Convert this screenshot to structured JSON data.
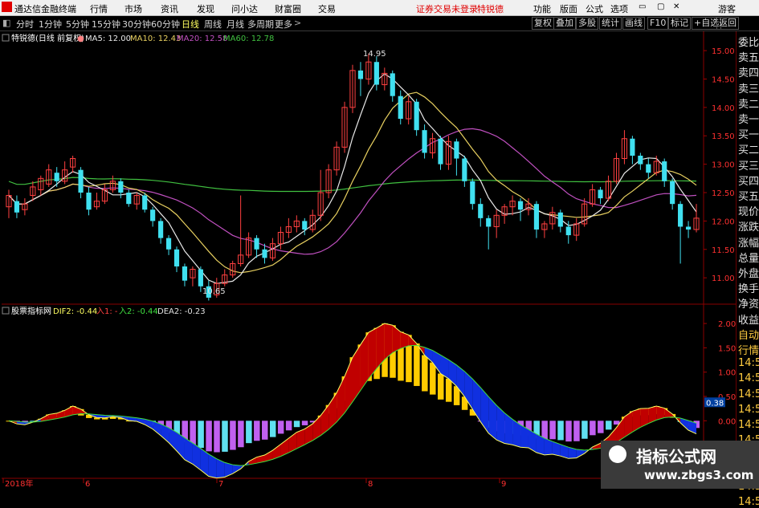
{
  "menubar": {
    "app_title": "通达信金融终端",
    "menus": [
      "行情",
      "市场",
      "资讯",
      "发现",
      "问小达",
      "财富圈",
      "交易"
    ],
    "status": "证券交易未登录",
    "stock": "特锐德",
    "right": [
      "功能",
      "版面",
      "公式",
      "选项",
      "游客"
    ]
  },
  "periodbar": {
    "periods": [
      "分时",
      "1分钟",
      "5分钟",
      "15分钟",
      "30分钟",
      "60分钟",
      "日线",
      "周线",
      "月线",
      "多周期",
      "更多"
    ],
    "active": "日线",
    "tools": [
      "复权",
      "叠加",
      "多股",
      "统计",
      "画线",
      "F10",
      "标记",
      "+自选",
      "返回"
    ]
  },
  "main_panel": {
    "title": "特锐德(日线 前复权)",
    "ma": [
      {
        "label": "MA5: 12.00",
        "color": "#e8e8e8"
      },
      {
        "label": "MA10: 12.43",
        "color": "#e8d060"
      },
      {
        "label": "MA20: 12.58",
        "color": "#c050c0"
      },
      {
        "label": "MA60: 12.78",
        "color": "#40c040"
      }
    ],
    "high_label": "14.95",
    "low_label": "10.65",
    "price_ticks": [
      "15.00",
      "14.50",
      "14.00",
      "13.50",
      "13.00",
      "12.50",
      "12.00",
      "11.50",
      "11.00"
    ]
  },
  "sub_panel": {
    "title": "股票指标网",
    "dif": "DIF2: -0.44",
    "in1": "入1: -",
    "in2": "入2: -0.44",
    "dea": "DEA2: -0.23",
    "ticks": [
      "2.00",
      "1.50",
      "1.00",
      "0.50",
      "0.00"
    ],
    "tag_value": "0.38"
  },
  "date_axis": [
    "2018年",
    "6",
    "7",
    "8",
    "9"
  ],
  "right_panel": [
    "委比",
    "卖五",
    "卖四",
    "卖三",
    "卖二",
    "卖一",
    "买一",
    "买二",
    "买三",
    "买四",
    "买五",
    "现价",
    "涨跌",
    "涨幅",
    "总量",
    "外盘",
    "换手",
    "净资",
    "收益",
    "自动",
    "行情",
    "14:50",
    "14:50",
    "14:50",
    "14:50",
    "14:50",
    "14:50",
    "14:50",
    "14:50",
    "14:50",
    "14:50"
  ],
  "watermark": {
    "title": "指标公式网",
    "url": "www.zbgs3.com"
  },
  "colors": {
    "up": "#ff4040",
    "down": "#40e0f0",
    "macd_pos": "#ffcc00",
    "macd_neg": "#c060f0",
    "bg": "#000000"
  },
  "chart_data": {
    "type": "candlestick",
    "note": "daily candles, prices estimated",
    "candles": [
      [
        12.25,
        12.45,
        12.05,
        12.55
      ],
      [
        12.35,
        12.15,
        12.05,
        12.45
      ],
      [
        12.2,
        12.3,
        12.1,
        12.4
      ],
      [
        12.45,
        12.6,
        12.35,
        12.7
      ],
      [
        12.55,
        12.75,
        12.45,
        12.8
      ],
      [
        12.65,
        12.9,
        12.6,
        13.0
      ],
      [
        12.85,
        12.7,
        12.6,
        12.95
      ],
      [
        12.7,
        12.9,
        12.65,
        13.05
      ],
      [
        12.95,
        13.1,
        12.85,
        13.15
      ],
      [
        12.9,
        12.5,
        12.4,
        12.95
      ],
      [
        12.5,
        12.2,
        12.1,
        12.6
      ],
      [
        12.25,
        12.35,
        12.2,
        12.5
      ],
      [
        12.35,
        12.55,
        12.3,
        12.65
      ],
      [
        12.55,
        12.7,
        12.5,
        12.8
      ],
      [
        12.7,
        12.5,
        12.4,
        12.75
      ],
      [
        12.5,
        12.3,
        12.25,
        12.55
      ],
      [
        12.3,
        12.45,
        12.2,
        12.5
      ],
      [
        12.45,
        12.2,
        12.15,
        12.5
      ],
      [
        12.2,
        12.0,
        11.9,
        12.25
      ],
      [
        12.0,
        11.7,
        11.6,
        12.05
      ],
      [
        11.7,
        11.5,
        11.4,
        11.75
      ],
      [
        11.5,
        11.2,
        11.1,
        11.55
      ],
      [
        11.2,
        10.95,
        10.85,
        11.25
      ],
      [
        11.0,
        11.15,
        10.85,
        11.2
      ],
      [
        11.15,
        10.85,
        10.75,
        11.2
      ],
      [
        10.85,
        10.65,
        10.6,
        10.95
      ],
      [
        10.7,
        10.9,
        10.65,
        11.0
      ],
      [
        10.9,
        11.05,
        10.85,
        11.15
      ],
      [
        11.05,
        11.25,
        11.0,
        11.3
      ],
      [
        11.25,
        11.4,
        11.2,
        12.45
      ],
      [
        11.4,
        11.7,
        11.35,
        11.8
      ],
      [
        11.7,
        11.5,
        11.35,
        11.75
      ],
      [
        11.5,
        11.35,
        11.25,
        11.6
      ],
      [
        11.35,
        11.6,
        11.3,
        11.7
      ],
      [
        11.6,
        11.8,
        11.5,
        11.9
      ],
      [
        11.8,
        11.9,
        11.7,
        12.05
      ],
      [
        11.9,
        12.0,
        11.8,
        12.1
      ],
      [
        12.0,
        11.85,
        11.75,
        12.05
      ],
      [
        11.85,
        12.1,
        11.8,
        12.2
      ],
      [
        12.1,
        12.5,
        12.0,
        12.9
      ],
      [
        12.5,
        12.9,
        12.4,
        13.0
      ],
      [
        12.9,
        13.3,
        12.8,
        13.4
      ],
      [
        13.3,
        14.0,
        13.2,
        14.1
      ],
      [
        14.0,
        14.65,
        13.9,
        14.75
      ],
      [
        14.65,
        14.5,
        14.2,
        14.8
      ],
      [
        14.5,
        14.8,
        14.4,
        14.95
      ],
      [
        14.8,
        14.4,
        14.3,
        14.9
      ],
      [
        14.4,
        14.6,
        14.3,
        14.7
      ],
      [
        14.6,
        14.2,
        14.1,
        14.65
      ],
      [
        14.2,
        13.8,
        13.7,
        14.3
      ],
      [
        13.8,
        14.1,
        13.7,
        14.2
      ],
      [
        14.1,
        13.6,
        13.5,
        14.15
      ],
      [
        13.6,
        13.2,
        13.1,
        13.7
      ],
      [
        13.2,
        13.45,
        13.1,
        13.55
      ],
      [
        13.45,
        13.0,
        12.9,
        13.5
      ],
      [
        13.0,
        13.4,
        12.9,
        13.5
      ],
      [
        13.4,
        13.1,
        12.8,
        13.45
      ],
      [
        13.1,
        12.7,
        12.6,
        13.15
      ],
      [
        12.7,
        12.3,
        12.2,
        12.75
      ],
      [
        12.3,
        12.05,
        11.9,
        12.4
      ],
      [
        12.05,
        11.9,
        11.5,
        12.1
      ],
      [
        11.9,
        12.1,
        11.7,
        12.2
      ],
      [
        12.1,
        12.25,
        11.95,
        12.3
      ],
      [
        12.25,
        12.35,
        12.1,
        12.45
      ],
      [
        12.35,
        12.2,
        12.0,
        12.4
      ],
      [
        12.2,
        12.3,
        12.1,
        12.4
      ],
      [
        12.3,
        11.85,
        11.7,
        12.35
      ],
      [
        11.85,
        11.95,
        11.7,
        12.0
      ],
      [
        11.95,
        12.15,
        11.85,
        12.25
      ],
      [
        12.15,
        11.9,
        11.8,
        12.2
      ],
      [
        11.9,
        11.75,
        11.6,
        12.0
      ],
      [
        11.75,
        11.95,
        11.65,
        12.05
      ],
      [
        11.95,
        12.3,
        11.9,
        12.4
      ],
      [
        12.3,
        12.55,
        12.25,
        12.65
      ],
      [
        12.55,
        12.4,
        12.3,
        12.6
      ],
      [
        12.4,
        12.7,
        12.35,
        12.8
      ],
      [
        12.7,
        13.1,
        12.65,
        13.2
      ],
      [
        13.1,
        13.45,
        13.0,
        13.6
      ],
      [
        13.45,
        13.15,
        13.0,
        13.5
      ],
      [
        13.15,
        13.0,
        12.9,
        13.2
      ],
      [
        13.0,
        12.85,
        12.75,
        13.1
      ],
      [
        12.85,
        13.05,
        12.8,
        13.15
      ],
      [
        13.05,
        12.7,
        12.6,
        13.1
      ],
      [
        12.7,
        12.3,
        12.2,
        12.75
      ],
      [
        12.3,
        11.9,
        11.25,
        12.35
      ],
      [
        11.9,
        11.85,
        11.7,
        12.0
      ],
      [
        11.85,
        12.05,
        11.8,
        12.3
      ]
    ]
  }
}
